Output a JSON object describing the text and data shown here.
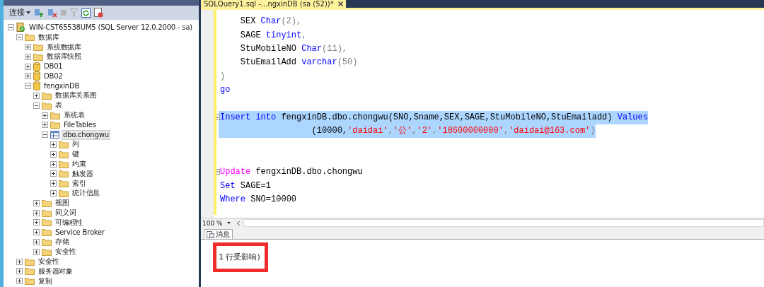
{
  "object_explorer": {
    "toolbar": {
      "connect_label": "连接"
    },
    "tree": [
      {
        "label": "WIN-CST65538UM5 (SQL Server 12.0.2000 - sa)",
        "kind": "server",
        "expanded": true,
        "selected": false,
        "children": [
          {
            "label": "数据库",
            "kind": "folder",
            "expanded": true,
            "selected": false,
            "children": [
              {
                "label": "系统数据库",
                "kind": "folder",
                "expanded": false,
                "selected": false
              },
              {
                "label": "数据库快照",
                "kind": "folder",
                "expanded": false,
                "selected": false
              },
              {
                "label": "DB01",
                "kind": "database",
                "expanded": false,
                "selected": false
              },
              {
                "label": "DB02",
                "kind": "database",
                "expanded": false,
                "selected": false
              },
              {
                "label": "fengxinDB",
                "kind": "database",
                "expanded": true,
                "selected": false,
                "children": [
                  {
                    "label": "数据库关系图",
                    "kind": "folder",
                    "expanded": false,
                    "selected": false
                  },
                  {
                    "label": "表",
                    "kind": "folder",
                    "expanded": true,
                    "selected": false,
                    "children": [
                      {
                        "label": "系统表",
                        "kind": "folder",
                        "expanded": false,
                        "selected": false
                      },
                      {
                        "label": "FileTables",
                        "kind": "folder",
                        "expanded": false,
                        "selected": false
                      },
                      {
                        "label": "dbo.chongwu",
                        "kind": "table",
                        "expanded": true,
                        "selected": true,
                        "children": [
                          {
                            "label": "列",
                            "kind": "folder",
                            "expanded": false,
                            "selected": false
                          },
                          {
                            "label": "键",
                            "kind": "folder",
                            "expanded": false,
                            "selected": false
                          },
                          {
                            "label": "约束",
                            "kind": "folder",
                            "expanded": false,
                            "selected": false
                          },
                          {
                            "label": "触发器",
                            "kind": "folder",
                            "expanded": false,
                            "selected": false
                          },
                          {
                            "label": "索引",
                            "kind": "folder",
                            "expanded": false,
                            "selected": false
                          },
                          {
                            "label": "统计信息",
                            "kind": "folder",
                            "expanded": false,
                            "selected": false
                          }
                        ]
                      }
                    ]
                  },
                  {
                    "label": "视图",
                    "kind": "folder",
                    "expanded": false,
                    "selected": false
                  },
                  {
                    "label": "同义词",
                    "kind": "folder",
                    "expanded": false,
                    "selected": false
                  },
                  {
                    "label": "可编程性",
                    "kind": "folder",
                    "expanded": false,
                    "selected": false
                  },
                  {
                    "label": "Service Broker",
                    "kind": "folder",
                    "expanded": false,
                    "selected": false
                  },
                  {
                    "label": "存储",
                    "kind": "folder",
                    "expanded": false,
                    "selected": false
                  },
                  {
                    "label": "安全性",
                    "kind": "folder",
                    "expanded": false,
                    "selected": false
                  }
                ]
              }
            ]
          },
          {
            "label": "安全性",
            "kind": "folder",
            "expanded": false,
            "selected": false
          },
          {
            "label": "服务器对象",
            "kind": "folder",
            "expanded": false,
            "selected": false
          },
          {
            "label": "复制",
            "kind": "folder",
            "expanded": false,
            "selected": false
          }
        ]
      }
    ]
  },
  "editor": {
    "tab_title": "SQLQuery1.sql -...ngxinDB (sa (52))*",
    "lines": [
      {
        "selected": false,
        "collapsible": false,
        "tokens": [
          {
            "kind": "plain",
            "text": "    SEX "
          },
          {
            "kind": "keyword",
            "text": "Char"
          },
          {
            "kind": "punct",
            "text": "(2),"
          }
        ]
      },
      {
        "selected": false,
        "collapsible": false,
        "tokens": [
          {
            "kind": "plain",
            "text": "    SAGE "
          },
          {
            "kind": "keyword",
            "text": "tinyint"
          },
          {
            "kind": "punct",
            "text": ","
          }
        ]
      },
      {
        "selected": false,
        "collapsible": false,
        "tokens": [
          {
            "kind": "plain",
            "text": "    StuMobileNO "
          },
          {
            "kind": "keyword",
            "text": "Char"
          },
          {
            "kind": "punct",
            "text": "(11),"
          }
        ]
      },
      {
        "selected": false,
        "collapsible": false,
        "tokens": [
          {
            "kind": "plain",
            "text": "    StuEmailAdd "
          },
          {
            "kind": "keyword",
            "text": "varchar"
          },
          {
            "kind": "punct",
            "text": "(50)"
          }
        ]
      },
      {
        "selected": false,
        "collapsible": false,
        "tokens": [
          {
            "kind": "punct",
            "text": ")"
          }
        ]
      },
      {
        "selected": false,
        "collapsible": false,
        "tokens": [
          {
            "kind": "keyword",
            "text": "go"
          }
        ]
      },
      {
        "selected": false,
        "collapsible": false
      },
      {
        "selected": true,
        "collapsible": true,
        "tokens": [
          {
            "kind": "keyword",
            "text": "Insert into"
          },
          {
            "kind": "plain",
            "text": " fengxinDB.dbo.chongwu(SNO,Sname,SEX,SAGE,StuMobileNO,StuEmailadd) "
          },
          {
            "kind": "keyword",
            "text": "Values"
          }
        ]
      },
      {
        "selected": true,
        "collapsible": false,
        "tokens": [
          {
            "kind": "plain",
            "text": "                  (10000,"
          },
          {
            "kind": "string",
            "text": "'daidai'"
          },
          {
            "kind": "punct",
            "text": ","
          },
          {
            "kind": "string",
            "text": "'公'"
          },
          {
            "kind": "punct",
            "text": ","
          },
          {
            "kind": "string",
            "text": "'2'"
          },
          {
            "kind": "punct",
            "text": ","
          },
          {
            "kind": "string",
            "text": "'18600000000'"
          },
          {
            "kind": "punct",
            "text": ","
          },
          {
            "kind": "string",
            "text": "'daidai@163.com'"
          },
          {
            "kind": "punct",
            "text": ")"
          }
        ]
      },
      {
        "selected": false,
        "collapsible": false
      },
      {
        "selected": false,
        "collapsible": false
      },
      {
        "selected": false,
        "collapsible": true,
        "tokens": [
          {
            "kind": "dml",
            "text": "Update"
          },
          {
            "kind": "plain",
            "text": " fengxinDB.dbo.chongwu"
          }
        ]
      },
      {
        "selected": false,
        "collapsible": false,
        "tokens": [
          {
            "kind": "keyword",
            "text": "Set"
          },
          {
            "kind": "plain",
            "text": " SAGE=1"
          }
        ]
      },
      {
        "selected": false,
        "collapsible": false,
        "tokens": [
          {
            "kind": "keyword",
            "text": "Where"
          },
          {
            "kind": "plain",
            "text": " SNO=10000"
          }
        ]
      }
    ],
    "zoom": "100 %"
  },
  "results": {
    "tabs": [
      {
        "label": "消息",
        "selected": true
      }
    ],
    "message": "1 行受影响)",
    "highlighted": true
  }
}
